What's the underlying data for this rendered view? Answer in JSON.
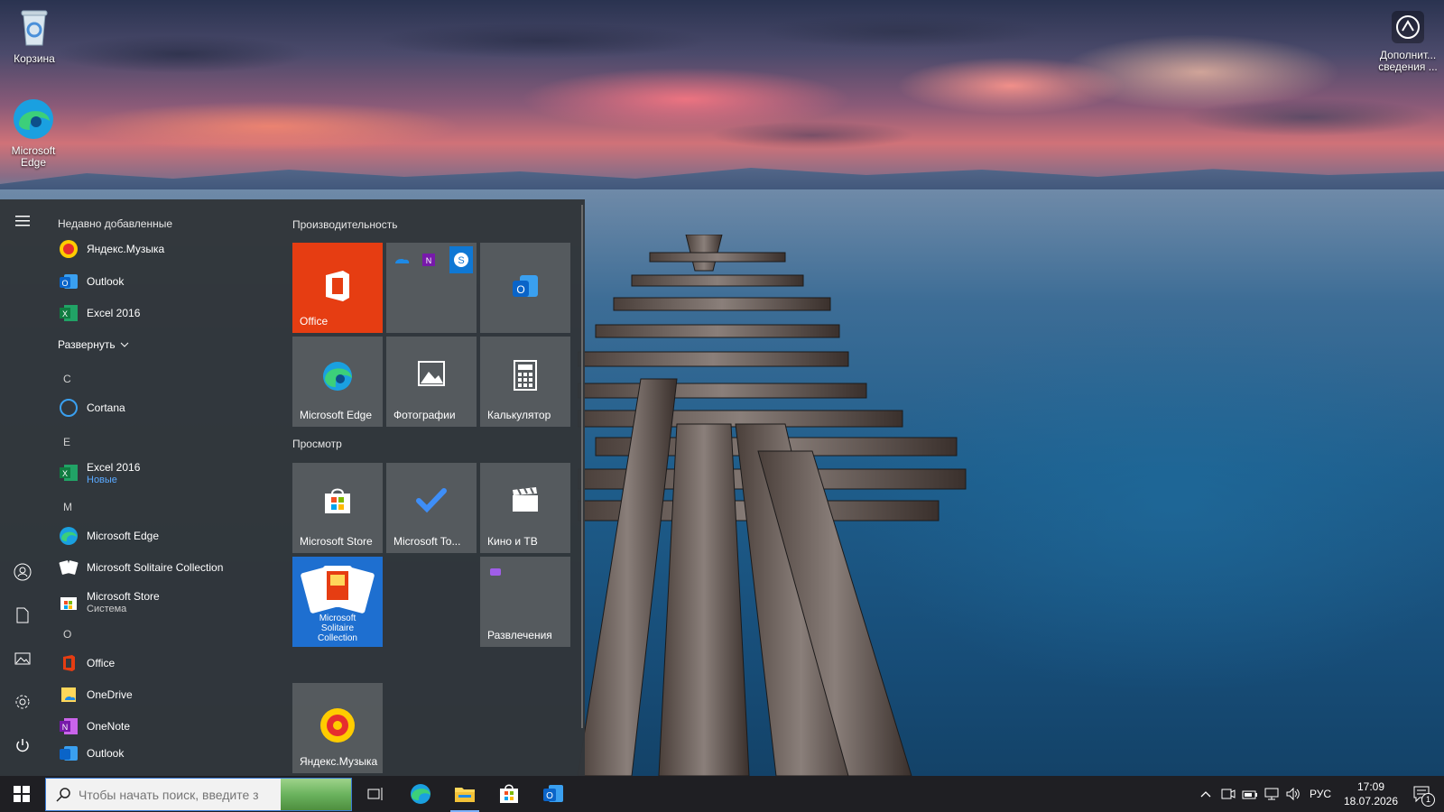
{
  "desktop": {
    "icons": [
      {
        "label": "Корзина"
      },
      {
        "label": "Microsoft Edge"
      },
      {
        "label": "Дополнит... сведения ..."
      }
    ]
  },
  "start_menu": {
    "recent_header": "Недавно добавленные",
    "recent": [
      {
        "label": "Яндекс.Музыка"
      },
      {
        "label": "Outlook"
      },
      {
        "label": "Excel 2016"
      }
    ],
    "expand_label": "Развернуть",
    "letters": [
      "C",
      "E",
      "M",
      "O"
    ],
    "apps": {
      "cortana": "Cortana",
      "excel": {
        "label": "Excel 2016",
        "sub": "Новые"
      },
      "edge": "Microsoft Edge",
      "solitaire": "Microsoft Solitaire Collection",
      "store": {
        "label": "Microsoft Store",
        "sub": "Система"
      },
      "office": "Office",
      "onedrive": "OneDrive",
      "onenote": "OneNote",
      "outlook": "Outlook"
    },
    "groups": [
      {
        "title": "Производительность"
      },
      {
        "title": "Просмотр"
      }
    ],
    "tiles": {
      "office": "Office",
      "edge": "Microsoft Edge",
      "photos": "Фотографии",
      "calculator": "Калькулятор",
      "store": "Microsoft Store",
      "todo": "Microsoft To...",
      "movies": "Кино и ТВ",
      "solitaire": "Microsoft Solitaire Collection",
      "entertainment": "Развлечения",
      "yandex_music": "Яндекс.Музыка"
    }
  },
  "taskbar": {
    "search_placeholder": "Чтобы начать поиск, введите з",
    "language": "РУС",
    "time": "17:09",
    "date": "18.07.2026",
    "notification_count": "1"
  },
  "colors": {
    "office_tile": "#e63d12",
    "accent": "#0078d7",
    "taskbar": "#1f1f23"
  }
}
